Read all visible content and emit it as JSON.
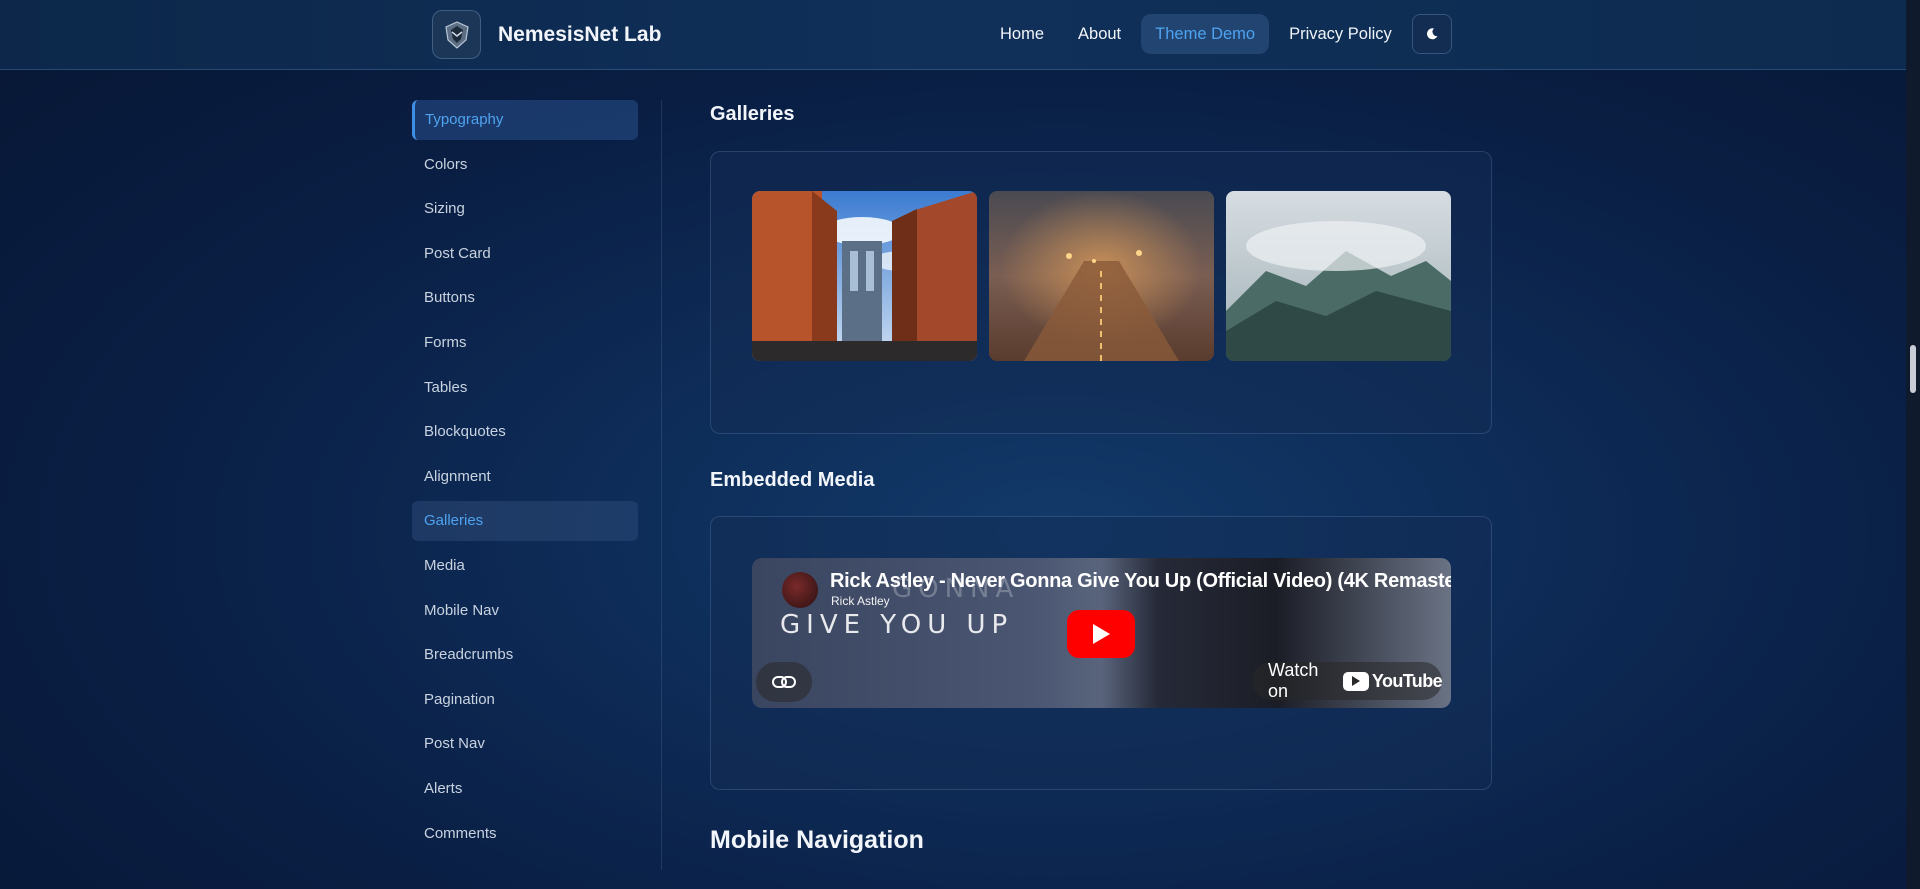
{
  "header": {
    "brand_name": "NemesisNet Lab",
    "nav": [
      "Home",
      "About",
      "Theme Demo",
      "Privacy Policy"
    ],
    "active_nav": "Theme Demo"
  },
  "sidebar": {
    "items": [
      "Typography",
      "Colors",
      "Sizing",
      "Post Card",
      "Buttons",
      "Forms",
      "Tables",
      "Blockquotes",
      "Alignment",
      "Galleries",
      "Media",
      "Mobile Nav",
      "Breadcrumbs",
      "Pagination",
      "Post Nav",
      "Alerts",
      "Comments"
    ]
  },
  "main": {
    "galleries_title": "Galleries",
    "media_title": "Embedded Media",
    "mobile_nav_title": "Mobile Navigation"
  },
  "video": {
    "title": "Rick Astley - Never Gonna Give You Up (Official Video) (4K Remaster",
    "channel": "Rick Astley",
    "overlay_text": "GIVE YOU UP",
    "overlay_text_top": "GONNA",
    "watch_label": "Watch on",
    "platform": "YouTube"
  },
  "colors": {
    "accent": "#4fa3f0",
    "youtube_red": "#ff0000"
  },
  "icons": {
    "logo": "shield-logo-icon",
    "theme": "moon-icon",
    "play": "play-icon",
    "link": "link-icon"
  }
}
